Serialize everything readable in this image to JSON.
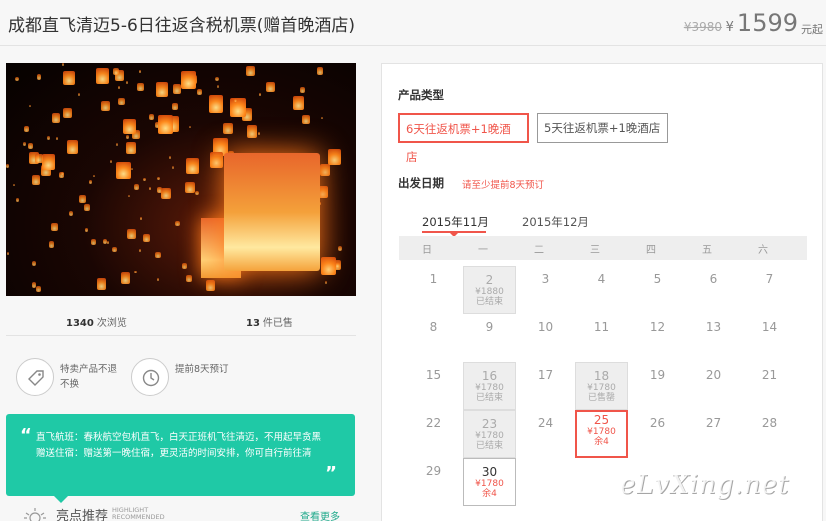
{
  "header": {
    "title": "成都直飞清迈5-6日往返含税机票(赠首晚酒店)",
    "original_price": "¥3980",
    "currency": "¥",
    "price": "1599",
    "price_unit": "元起"
  },
  "stats": {
    "views_count": "1340",
    "views_label": "次浏览",
    "sold_count": "13",
    "sold_label": "件已售"
  },
  "features": [
    {
      "icon": "tag-icon",
      "text": "特卖产品不退不换"
    },
    {
      "icon": "clock-icon",
      "text": "提前8天预订"
    }
  ],
  "promo": {
    "open_quote": "“",
    "line1": "直飞航班：春秋航空包机直飞，白天正班机飞往清迈，不用起早贪黑",
    "line2": "赠送住宿：赠送第一晚住宿，更灵活的时间安排，你可自行前往清",
    "close_quote": "”"
  },
  "highlight": {
    "title": "亮点推荐",
    "en1": "HIGHLIGHT",
    "en2": "RECOMMENDED",
    "more": "查看更多"
  },
  "booking": {
    "product_type_label": "产品类型",
    "product_types": [
      {
        "label": "6天往返机票+1晚酒店",
        "selected": true
      },
      {
        "label": "5天往返机票+1晚酒店",
        "selected": false
      }
    ],
    "departure_label": "出发日期",
    "advance_note": "请至少提前8天预订",
    "months": [
      "2015年11月",
      "2015年12月"
    ],
    "active_month": "2015年11月",
    "weekdays": [
      "日",
      "一",
      "二",
      "三",
      "四",
      "五",
      "六"
    ],
    "days": [
      {
        "n": "1"
      },
      {
        "n": "2",
        "price": "¥1880",
        "status": "已结束",
        "state": "gray"
      },
      {
        "n": "3"
      },
      {
        "n": "4"
      },
      {
        "n": "5"
      },
      {
        "n": "6"
      },
      {
        "n": "7"
      },
      {
        "n": "8"
      },
      {
        "n": "9"
      },
      {
        "n": "10"
      },
      {
        "n": "11"
      },
      {
        "n": "12"
      },
      {
        "n": "13"
      },
      {
        "n": "14"
      },
      {
        "n": "15"
      },
      {
        "n": "16",
        "price": "¥1780",
        "status": "已结束",
        "state": "gray"
      },
      {
        "n": "17"
      },
      {
        "n": "18",
        "price": "¥1780",
        "status": "已售罄",
        "state": "gray"
      },
      {
        "n": "19"
      },
      {
        "n": "20"
      },
      {
        "n": "21"
      },
      {
        "n": "22"
      },
      {
        "n": "23",
        "price": "¥1780",
        "status": "已结束",
        "state": "gray"
      },
      {
        "n": "24"
      },
      {
        "n": "25",
        "price": "¥1780",
        "status": "余4",
        "state": "sel"
      },
      {
        "n": "26"
      },
      {
        "n": "27"
      },
      {
        "n": "28"
      },
      {
        "n": "29"
      },
      {
        "n": "30",
        "price": "¥1780",
        "status": "余4",
        "state": "avail"
      }
    ]
  },
  "watermark": "eLvXing.net",
  "colors": {
    "accent": "#f0554a",
    "teal": "#1fc9a6"
  }
}
